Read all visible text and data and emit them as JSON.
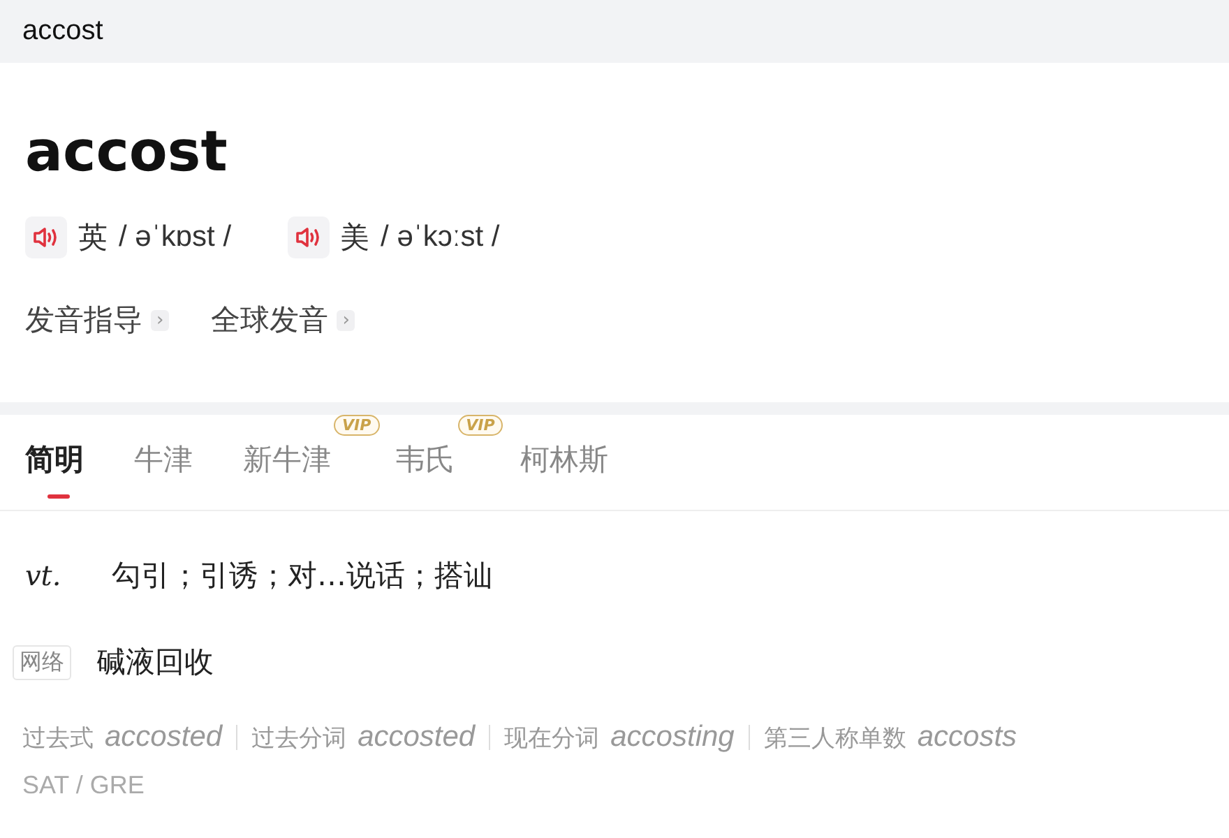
{
  "search": {
    "value": "accost"
  },
  "word": "accost",
  "pronunciations": [
    {
      "region": "英",
      "phonetic": "/ əˈkɒst /"
    },
    {
      "region": "美",
      "phonetic": "/ əˈkɔːst /"
    }
  ],
  "links": [
    {
      "label": "发音指导",
      "icon": "›"
    },
    {
      "label": "全球发音",
      "icon": "›"
    }
  ],
  "tabs": [
    {
      "label": "简明",
      "selected": true
    },
    {
      "label": "牛津",
      "selected": false
    },
    {
      "label": "新牛津",
      "selected": false,
      "badge": "VIP"
    },
    {
      "label": "韦氏",
      "selected": false,
      "badge": "VIP"
    },
    {
      "label": "柯林斯",
      "selected": false
    }
  ],
  "definitions": [
    {
      "kind": "pos",
      "label": "vt.",
      "text": "勾引；引诱；对…说话；搭讪"
    },
    {
      "kind": "tag",
      "label": "网络",
      "text": "碱液回收"
    }
  ],
  "forms": [
    {
      "label": "过去式",
      "value": "accosted"
    },
    {
      "label": "过去分词",
      "value": "accosted"
    },
    {
      "label": "现在分词",
      "value": "accosting"
    },
    {
      "label": "第三人称单数",
      "value": "accosts"
    }
  ],
  "exams": "SAT / GRE"
}
